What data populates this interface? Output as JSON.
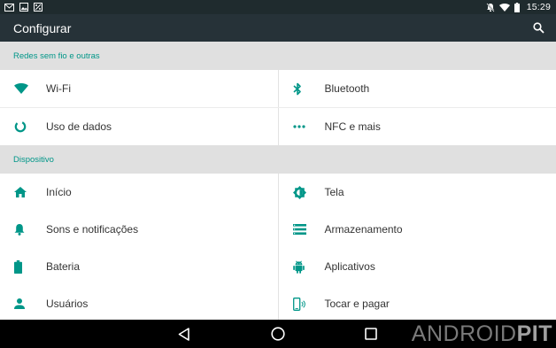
{
  "status_bar": {
    "time": "15:29",
    "left_icons": [
      "mail-icon",
      "image-icon",
      "document-icon"
    ],
    "right_icons": [
      "notifications-off-icon",
      "wifi-icon",
      "battery-icon"
    ]
  },
  "toolbar": {
    "title": "Configurar",
    "search_icon": "search-icon"
  },
  "sections": [
    {
      "title": "Redes sem fio e outras",
      "rows": [
        [
          {
            "label": "Wi-Fi",
            "icon": "wifi-icon"
          },
          {
            "label": "Bluetooth",
            "icon": "bluetooth-icon"
          }
        ],
        [
          {
            "label": "Uso de dados",
            "icon": "data-usage-icon"
          },
          {
            "label": "NFC e mais",
            "icon": "more-icon"
          }
        ]
      ]
    },
    {
      "title": "Dispositivo",
      "rows": [
        [
          {
            "label": "Início",
            "icon": "home-icon"
          },
          {
            "label": "Tela",
            "icon": "brightness-icon"
          }
        ],
        [
          {
            "label": "Sons e notificações",
            "icon": "bell-icon"
          },
          {
            "label": "Armazenamento",
            "icon": "storage-icon"
          }
        ],
        [
          {
            "label": "Bateria",
            "icon": "battery-icon"
          },
          {
            "label": "Aplicativos",
            "icon": "android-icon"
          }
        ],
        [
          {
            "label": "Usuários",
            "icon": "person-icon"
          },
          {
            "label": "Tocar e pagar",
            "icon": "tap-pay-icon"
          }
        ]
      ]
    }
  ],
  "nav_bar": {
    "back_icon": "back-icon",
    "home_icon": "home-circle-icon",
    "recents_icon": "recents-icon"
  },
  "watermark": {
    "text_light": "ANDROID",
    "text_bold": "PIT"
  },
  "colors": {
    "accent": "#009688",
    "toolbar": "#263238",
    "status_bar": "#1f2b2e",
    "section_bg": "#e0e0e0"
  }
}
